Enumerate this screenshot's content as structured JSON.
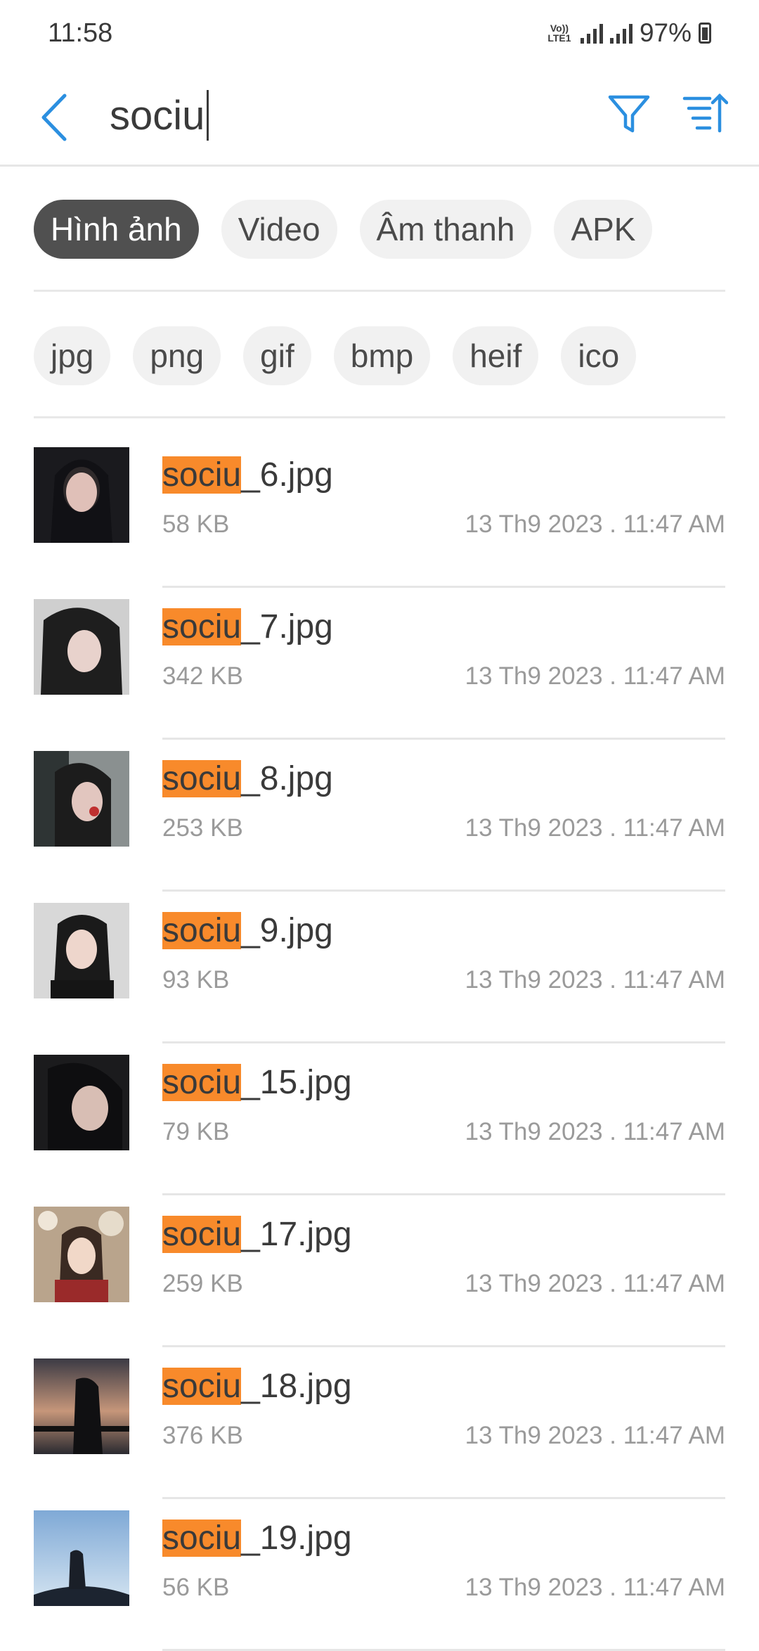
{
  "status": {
    "time": "11:58",
    "volte": "VoLTE1",
    "battery": "97%"
  },
  "search": {
    "query": "sociu"
  },
  "colors": {
    "accent": "#2b8fe0",
    "highlight": "#f88a2b",
    "chip_active": "#505050"
  },
  "category_chips": [
    {
      "label": "Hình ảnh",
      "active": true
    },
    {
      "label": "Video",
      "active": false
    },
    {
      "label": "Âm thanh",
      "active": false
    },
    {
      "label": "APK",
      "active": false
    }
  ],
  "extension_chips": [
    "jpg",
    "png",
    "gif",
    "bmp",
    "heif",
    "ico"
  ],
  "files": [
    {
      "match": "sociu",
      "rest": "_6.jpg",
      "size": "58 KB",
      "date": "13 Th9 2023 . 11:47 AM"
    },
    {
      "match": "sociu",
      "rest": "_7.jpg",
      "size": "342 KB",
      "date": "13 Th9 2023 . 11:47 AM"
    },
    {
      "match": "sociu",
      "rest": "_8.jpg",
      "size": "253 KB",
      "date": "13 Th9 2023 . 11:47 AM"
    },
    {
      "match": "sociu",
      "rest": "_9.jpg",
      "size": "93 KB",
      "date": "13 Th9 2023 . 11:47 AM"
    },
    {
      "match": "sociu",
      "rest": "_15.jpg",
      "size": "79 KB",
      "date": "13 Th9 2023 . 11:47 AM"
    },
    {
      "match": "sociu",
      "rest": "_17.jpg",
      "size": "259 KB",
      "date": "13 Th9 2023 . 11:47 AM"
    },
    {
      "match": "sociu",
      "rest": "_18.jpg",
      "size": "376 KB",
      "date": "13 Th9 2023 . 11:47 AM"
    },
    {
      "match": "sociu",
      "rest": "_19.jpg",
      "size": "56 KB",
      "date": "13 Th9 2023 . 11:47 AM"
    }
  ]
}
